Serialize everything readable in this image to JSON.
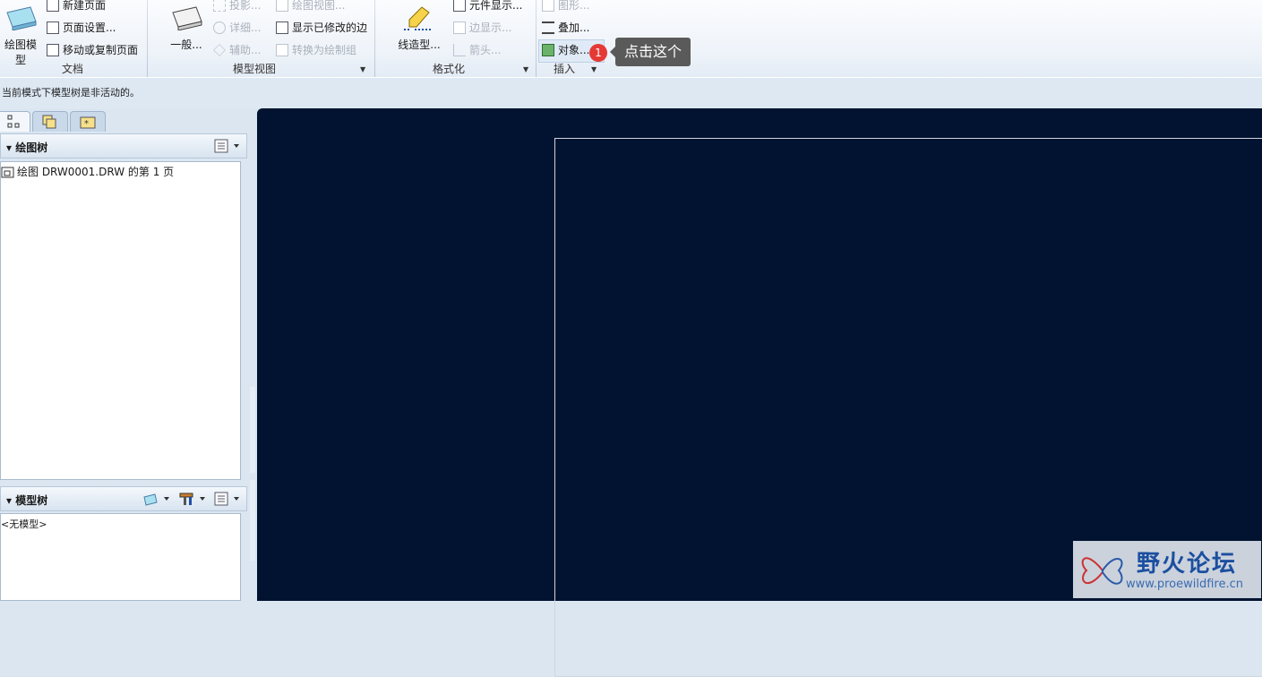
{
  "ribbon": {
    "document_group": {
      "big_label": "绘图模型",
      "items": [
        "新建页面",
        "页面设置...",
        "移动或复制页面"
      ],
      "label": "文档"
    },
    "model_views_group": {
      "big_label": "一般...",
      "items": [
        "投影...",
        "详细...",
        "辅助...",
        "绘图视图...",
        "显示已修改的边",
        "转换为绘制组"
      ],
      "label": "模型视图"
    },
    "format_group": {
      "big_label": "线造型...",
      "items": [
        "元件显示...",
        "边显示...",
        "箭头..."
      ],
      "label": "格式化"
    },
    "insert_group": {
      "items": [
        "图形...",
        "叠加...",
        "对象..."
      ],
      "label": "插入"
    }
  },
  "status": {
    "message": "当前模式下模型树是非活动的。"
  },
  "drawing_tree": {
    "title": "绘图树",
    "items": [
      "绘图 DRW0001.DRW 的第 1 页"
    ]
  },
  "model_tree": {
    "title": "模型树",
    "empty_text": "<无模型>"
  },
  "annotation": {
    "badge": "1",
    "tooltip": "点击这个"
  },
  "watermark": {
    "title": "野火论坛",
    "url": "www.proewildfire.cn"
  },
  "colors": {
    "canvas": "#011330",
    "badge": "#e53935"
  }
}
